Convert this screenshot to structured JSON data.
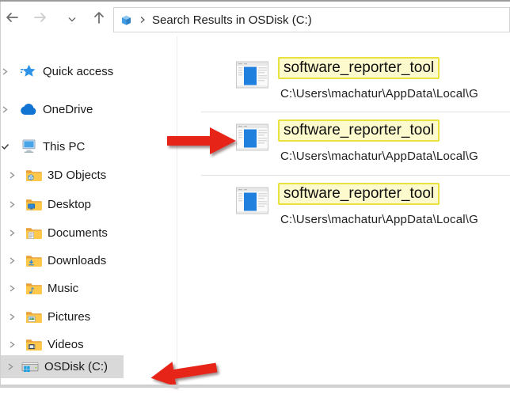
{
  "window_title": "Search Results in OSDisk (C:)",
  "toolbar": {
    "back_icon": "nav-back",
    "forward_icon": "nav-forward",
    "recent_locations_icon": "nav-recent",
    "up_icon": "nav-up",
    "address": {
      "location_icon": "cube",
      "breadcrumb": "Search Results in OSDisk (C:)"
    }
  },
  "sidebar": {
    "items": [
      {
        "label": "Quick access",
        "icon": "star",
        "chevron": "right",
        "level": 0,
        "selected": false
      },
      {
        "label": "OneDrive",
        "icon": "cloud",
        "chevron": "right",
        "level": 0,
        "selected": false
      },
      {
        "label": "This PC",
        "icon": "computer",
        "chevron": "down",
        "level": 0,
        "selected": false
      },
      {
        "label": "3D Objects",
        "icon": "folder-3d",
        "chevron": "right",
        "level": 1,
        "selected": false
      },
      {
        "label": "Desktop",
        "icon": "folder-desktop",
        "chevron": "right",
        "level": 1,
        "selected": false
      },
      {
        "label": "Documents",
        "icon": "folder-documents",
        "chevron": "right",
        "level": 1,
        "selected": false
      },
      {
        "label": "Downloads",
        "icon": "folder-downloads",
        "chevron": "right",
        "level": 1,
        "selected": false
      },
      {
        "label": "Music",
        "icon": "folder-music",
        "chevron": "right",
        "level": 1,
        "selected": false
      },
      {
        "label": "Pictures",
        "icon": "folder-pictures",
        "chevron": "right",
        "level": 1,
        "selected": false
      },
      {
        "label": "Videos",
        "icon": "folder-videos",
        "chevron": "right",
        "level": 1,
        "selected": false
      },
      {
        "label": "OSDisk (C:)",
        "icon": "drive",
        "chevron": "right",
        "level": 1,
        "selected": true
      }
    ]
  },
  "results": {
    "items": [
      {
        "name": "software_reporter_tool",
        "path": "C:\\Users\\machatur\\AppData\\Local\\G",
        "icon": "application",
        "highlighted": true
      },
      {
        "name": "software_reporter_tool",
        "path": "C:\\Users\\machatur\\AppData\\Local\\G",
        "icon": "application",
        "highlighted": true
      },
      {
        "name": "software_reporter_tool",
        "path": "C:\\Users\\machatur\\AppData\\Local\\G",
        "icon": "application",
        "highlighted": true
      }
    ]
  },
  "annotations": {
    "arrows": [
      {
        "icon": "red-arrow-right",
        "points_at": "second search result icon"
      },
      {
        "icon": "red-arrow-left",
        "points_at": "OSDisk (C:) sidebar item"
      }
    ]
  },
  "colors": {
    "highlight_bg": "#fdfacd",
    "highlight_border": "#e8e13e",
    "selection_bg": "#d9d9d9",
    "arrow": "#e62417",
    "folder": "#ffc84a",
    "accent_blue": "#1f80dd"
  }
}
